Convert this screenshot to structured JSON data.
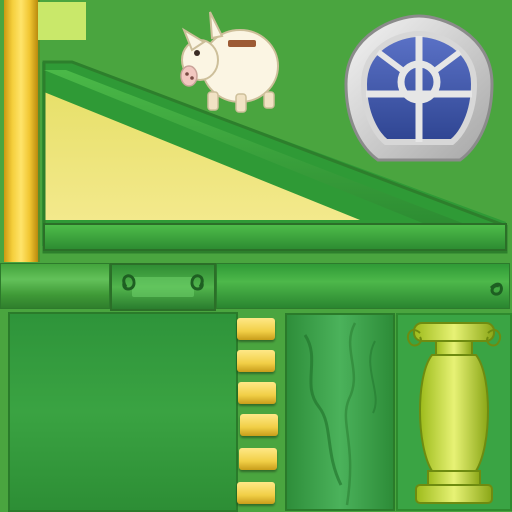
{
  "scene": {
    "type": "texture-atlas",
    "colors": {
      "background": "#4aa53f",
      "ramp_fill": "#f0e27a",
      "ramp_border": "#2f9a36",
      "accent_yellow": "#f5cf3c",
      "window_frame": "#d9d9d9",
      "window_glass": "#3d56a6"
    },
    "elements": [
      "yellow-post",
      "lime-swatch",
      "sloped-ramp",
      "piggy-bank-sprite",
      "round-window",
      "green-rail-plain",
      "green-rail-scroll",
      "green-rail-long",
      "green-panel",
      "yellow-brick-stack",
      "green-marble-block",
      "green-column-vase"
    ]
  }
}
